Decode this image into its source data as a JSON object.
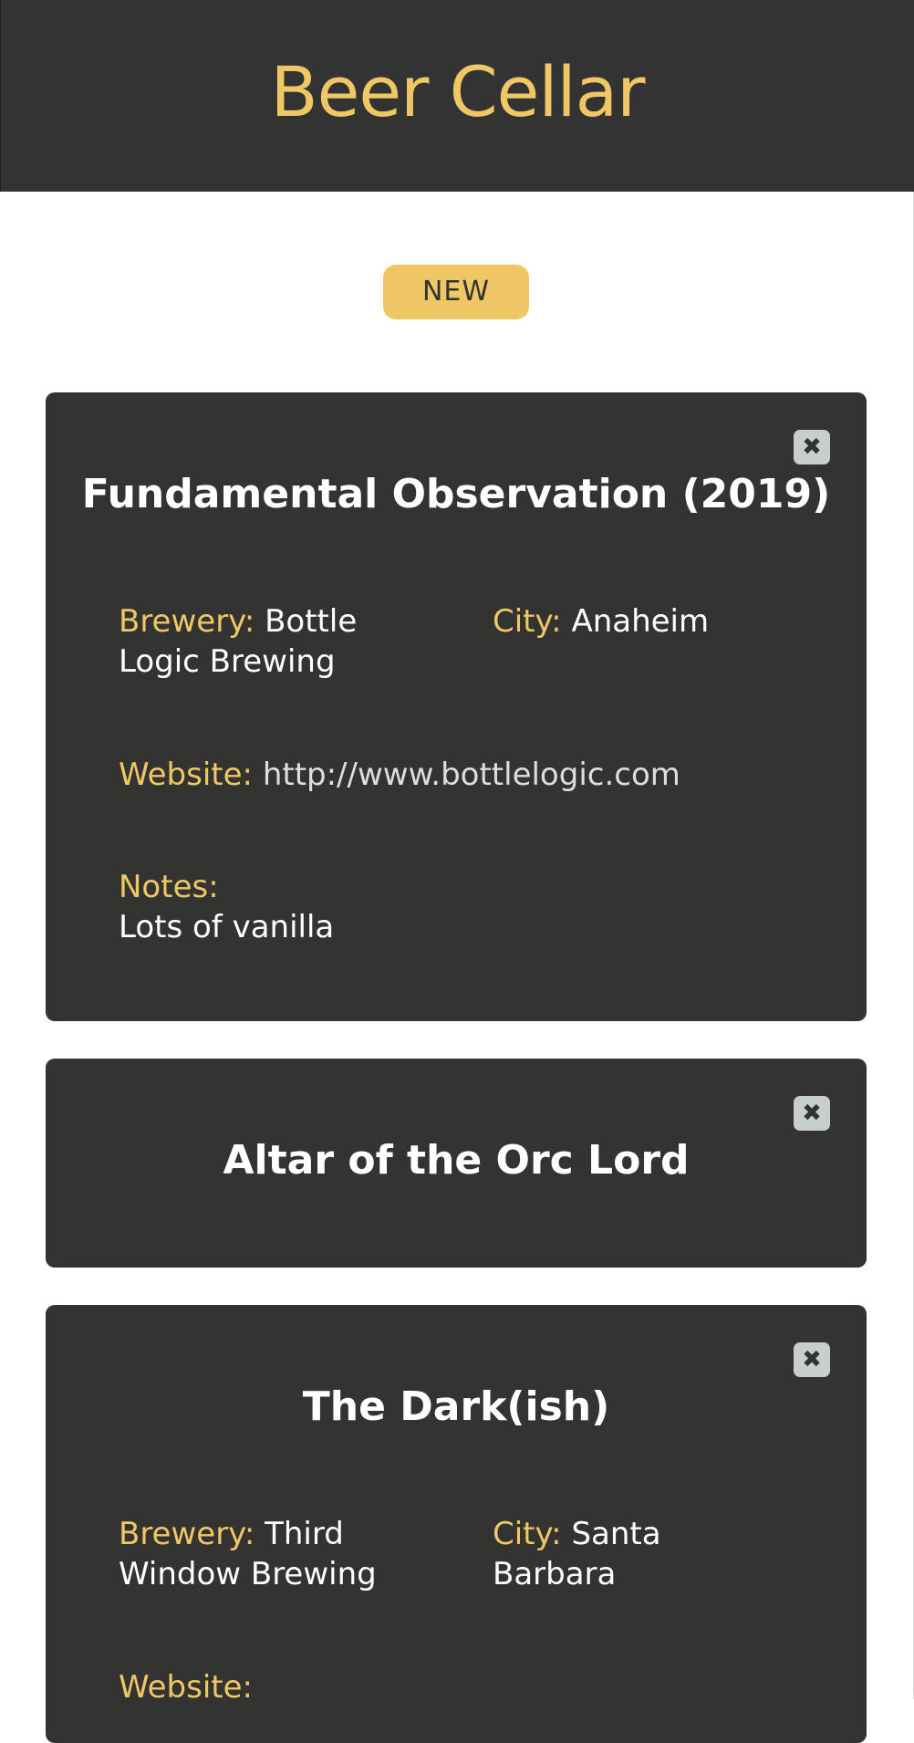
{
  "header": {
    "title": "Beer Cellar"
  },
  "actions": {
    "new_label": "NEW"
  },
  "labels": {
    "brewery": "Brewery:",
    "city": "City:",
    "website": "Website:",
    "notes": "Notes:"
  },
  "beers": [
    {
      "title": "Fundamental Observation (2019)",
      "brewery": "Bottle Logic Brewing",
      "city": "Anaheim",
      "website": "http://www.bottlelogic.com",
      "notes": "Lots of vanilla"
    },
    {
      "title": "Altar of the Orc Lord"
    },
    {
      "title": "The Dark(ish)",
      "brewery": "Third Window Brewing",
      "city": "Santa Barbara"
    }
  ],
  "close_symbol": "✖",
  "colors": {
    "accent": "#efc765",
    "header_bg": "#323332",
    "card_bg": "#333432",
    "close_bg": "#c8ceca"
  },
  "icons": {
    "close": "close-icon"
  }
}
